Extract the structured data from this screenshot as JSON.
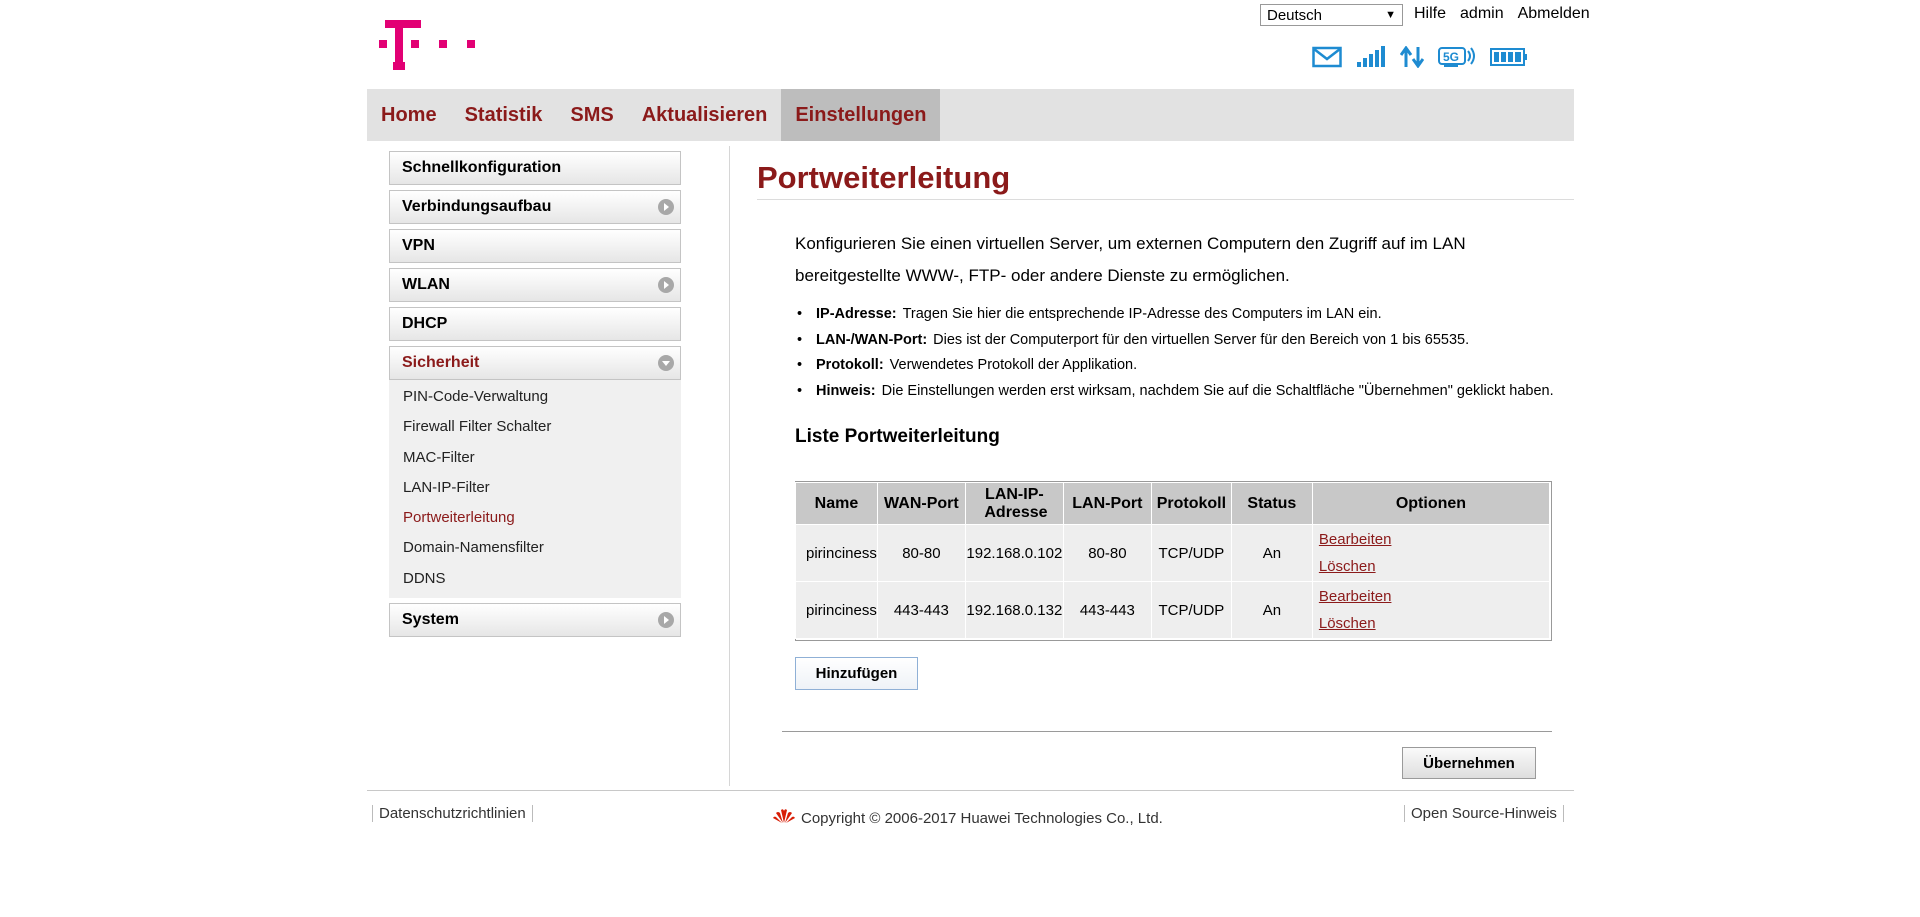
{
  "header": {
    "language": "Deutsch",
    "links": [
      "Hilfe",
      "admin",
      "Abmelden"
    ]
  },
  "status_icons": [
    "mail-icon",
    "signal-strength-icon",
    "data-transfer-icon",
    "network-5g-icon",
    "battery-icon"
  ],
  "colors": {
    "brand_magenta": "#E20074",
    "accent_red": "#8B1A1A",
    "icon_blue": "#1E8BD1"
  },
  "nav": {
    "items": [
      "Home",
      "Statistik",
      "SMS",
      "Aktualisieren",
      "Einstellungen"
    ],
    "active": "Einstellungen"
  },
  "sidebar": {
    "items": [
      "Schnellkonfiguration",
      "Verbindungsaufbau",
      "VPN",
      "WLAN",
      "DHCP",
      "Sicherheit",
      "System"
    ],
    "active": "Sicherheit",
    "submenu": [
      "PIN-Code-Verwaltung",
      "Firewall Filter Schalter",
      "MAC-Filter",
      "LAN-IP-Filter",
      "Portweiterleitung",
      "Domain-Namensfilter",
      "DDNS"
    ],
    "submenu_active": "Portweiterleitung"
  },
  "main": {
    "title": "Portweiterleitung",
    "intro": "Konfigurieren Sie einen virtuellen Server, um externen Computern den Zugriff auf im LAN bereitgestellte WWW-, FTP- oder andere Dienste zu ermöglichen.",
    "bullets": [
      {
        "term": "IP-Adresse:",
        "text": "Tragen Sie hier die entsprechende IP-Adresse des Computers im LAN ein."
      },
      {
        "term": "LAN-/WAN-Port:",
        "text": "Dies ist der Computerport für den virtuellen Server für den Bereich von 1 bis 65535."
      },
      {
        "term": "Protokoll:",
        "text": "Verwendetes Protokoll der Applikation."
      },
      {
        "term": "Hinweis:",
        "text": "Die Einstellungen werden erst wirksam, nachdem Sie auf die Schaltfläche \"Übernehmen\" geklickt haben."
      }
    ],
    "list_title": "Liste Portweiterleitung",
    "table": {
      "headers": [
        "Name",
        "WAN-Port",
        "LAN-IP-Adresse",
        "LAN-Port",
        "Protokoll",
        "Status",
        "Optionen"
      ],
      "rows": [
        {
          "name": "pirinciness",
          "wan_port": "80-80",
          "lan_ip": "192.168.0.102",
          "lan_port": "80-80",
          "protocol": "TCP/UDP",
          "status": "An",
          "edit": "Bearbeiten",
          "delete": "Löschen"
        },
        {
          "name": "pirinciness",
          "wan_port": "443-443",
          "lan_ip": "192.168.0.132",
          "lan_port": "443-443",
          "protocol": "TCP/UDP",
          "status": "An",
          "edit": "Bearbeiten",
          "delete": "Löschen"
        }
      ]
    },
    "add_button": "Hinzufügen",
    "apply_button": "Übernehmen"
  },
  "footer": {
    "privacy": "Datenschutzrichtlinien",
    "copyright": "Copyright © 2006-2017 Huawei Technologies Co., Ltd.",
    "open_source": "Open Source-Hinweis"
  }
}
